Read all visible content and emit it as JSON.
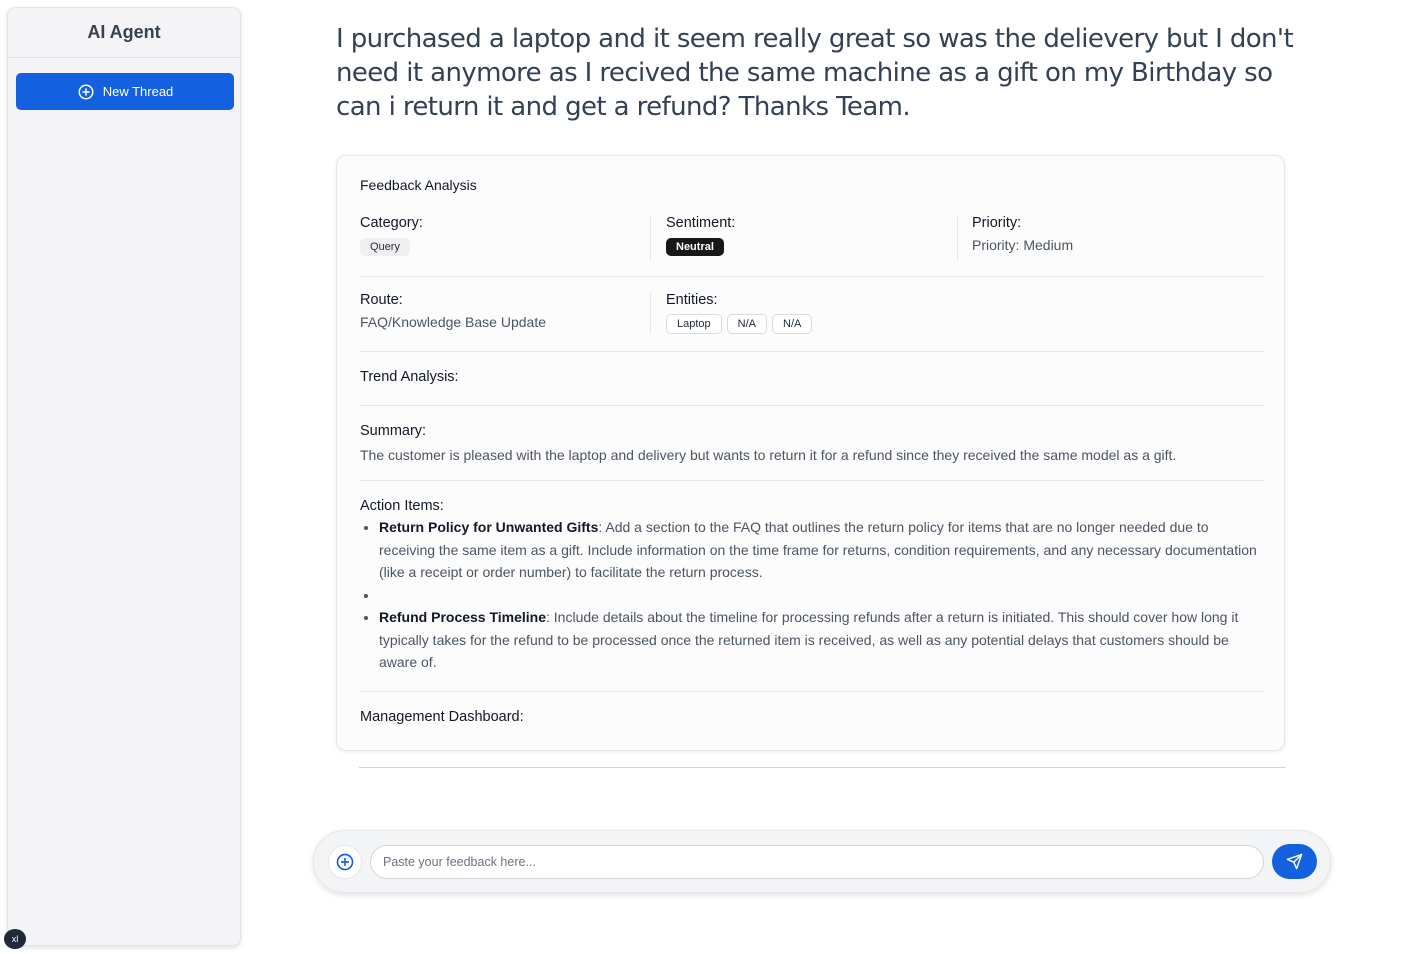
{
  "sidebar": {
    "title": "AI Agent",
    "new_thread_label": "New Thread",
    "new_thread_icon": "plus-circle-icon",
    "badge": "xl"
  },
  "question": "I purchased a laptop and it seem really great so was the delievery but I don't need it anymore as I recived the same machine as a gift on my Birthday so can i return it and get a refund? Thanks Team.",
  "analysis": {
    "title": "Feedback Analysis",
    "category_label": "Category:",
    "category_value": "Query",
    "sentiment_label": "Sentiment:",
    "sentiment_value": "Neutral",
    "priority_label": "Priority:",
    "priority_value": "Priority: Medium",
    "route_label": "Route:",
    "route_value": "FAQ/Knowledge Base Update",
    "entities_label": "Entities:",
    "entities": [
      "Laptop",
      "N/A",
      "N/A"
    ],
    "trend_label": "Trend Analysis:",
    "summary_label": "Summary:",
    "summary_text": "The customer is pleased with the laptop and delivery but wants to return it for a refund since they received the same model as a gift.",
    "action_items_label": "Action Items:",
    "action_items": [
      {
        "title": "Return Policy for Unwanted Gifts",
        "text": ": Add a section to the FAQ that outlines the return policy for items that are no longer needed due to receiving the same item as a gift. Include information on the time frame for returns, condition requirements, and any necessary documentation (like a receipt or order number) to facilitate the return process."
      },
      {
        "title": "",
        "text": ""
      },
      {
        "title": "Refund Process Timeline",
        "text": ": Include details about the timeline for processing refunds after a return is initiated. This should cover how long it typically takes for the refund to be processed once the returned item is received, as well as any potential delays that customers should be aware of."
      }
    ],
    "dashboard_label": "Management Dashboard:"
  },
  "composer": {
    "placeholder": "Paste your feedback here...",
    "attach_icon": "plus-circle-icon",
    "send_icon": "send-icon"
  },
  "colors": {
    "accent": "#1461e0",
    "sentiment_badge": "#18181b"
  }
}
